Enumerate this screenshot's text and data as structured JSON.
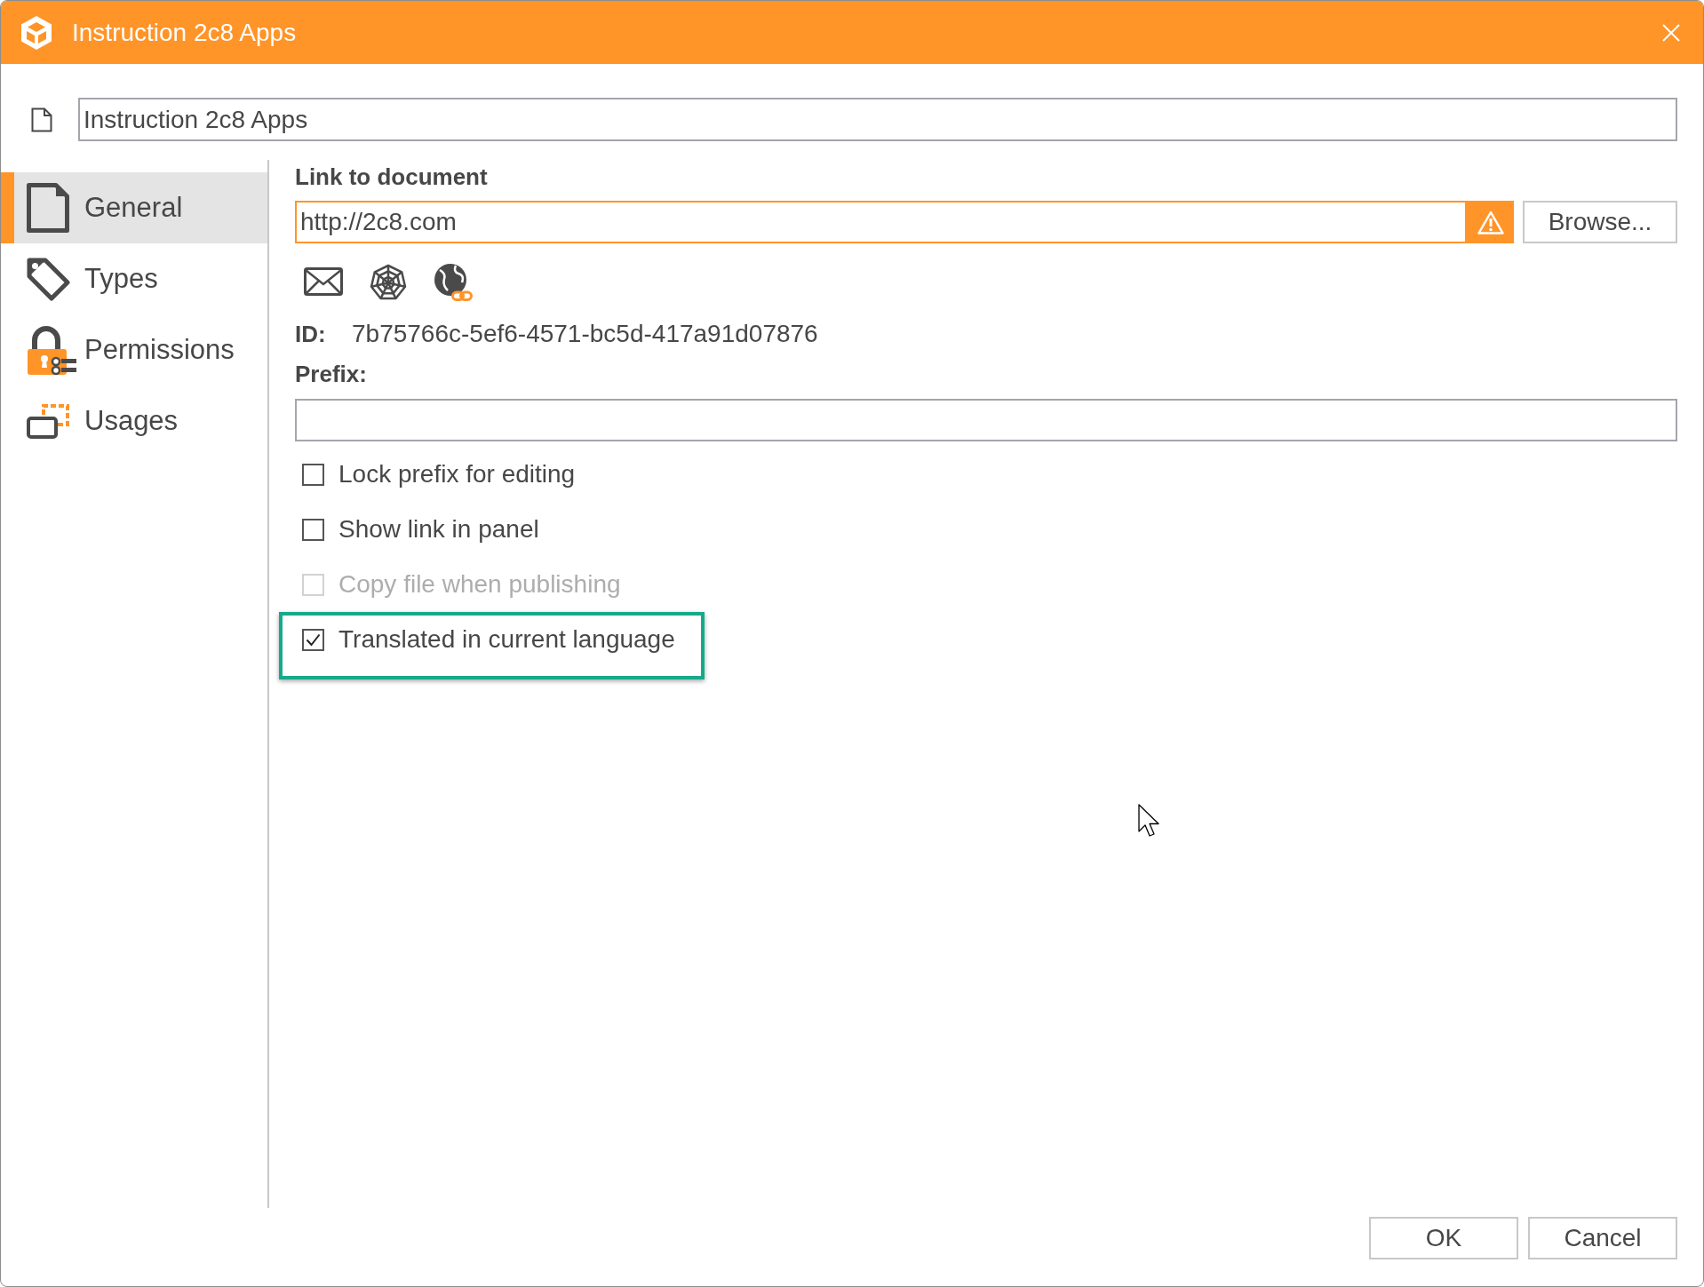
{
  "window": {
    "title": "Instruction 2c8 Apps"
  },
  "name_field": {
    "value": "Instruction 2c8 Apps"
  },
  "sidebar": {
    "items": [
      {
        "label": "General",
        "selected": true
      },
      {
        "label": "Types",
        "selected": false
      },
      {
        "label": "Permissions",
        "selected": false
      },
      {
        "label": "Usages",
        "selected": false
      }
    ]
  },
  "link": {
    "label": "Link to document",
    "value": "http://2c8.com",
    "warning": true,
    "browse_button": "Browse..."
  },
  "id": {
    "label": "ID:",
    "value": "7b75766c-5ef6-4571-bc5d-417a91d07876"
  },
  "prefix": {
    "label": "Prefix:"
  },
  "options": [
    {
      "label": "Lock prefix for editing",
      "checked": false,
      "disabled": false,
      "highlighted": false
    },
    {
      "label": "Show link in panel",
      "checked": false,
      "disabled": false,
      "highlighted": false
    },
    {
      "label": "Copy file when publishing",
      "checked": false,
      "disabled": true,
      "highlighted": false
    },
    {
      "label": "Translated in current language",
      "checked": true,
      "disabled": false,
      "highlighted": true
    }
  ],
  "buttons": [
    "OK",
    "Cancel"
  ]
}
